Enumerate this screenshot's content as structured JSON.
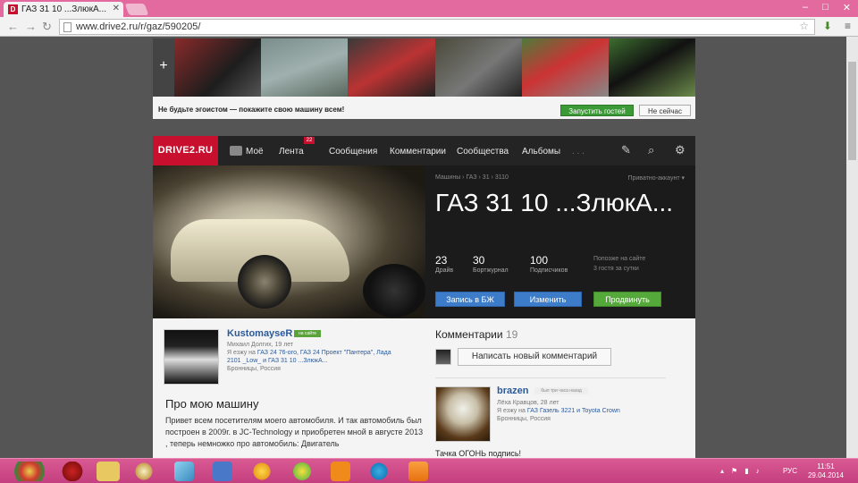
{
  "browser": {
    "tab_title": "ГАЗ 31 10 ...ЗлюкА...",
    "tab_favicon_letter": "D",
    "url": "www.drive2.ru/r/gaz/590205/",
    "win_min": "–",
    "win_max": "□",
    "win_close": "✕"
  },
  "promo": {
    "plus": "+",
    "text": "Не будьте эгоистом — покажите свою машину всем!",
    "launch_label": "Запустить гостей",
    "notnow_label": "Не сейчас"
  },
  "header": {
    "logo": "DRIVE2.RU",
    "menu": {
      "mine": "Моё",
      "feed": "Лента",
      "feed_badge": "22",
      "messages": "Сообщения",
      "comments": "Комментарии",
      "communities": "Сообщества",
      "albums": "Альбомы",
      "more": ". . ."
    }
  },
  "car": {
    "breadcrumb": "Машины › ГАЗ › 31 › 3110",
    "privacy": "Приватно-аккаунт ▾",
    "title": "ГАЗ 31 10 ...ЗлюкА...",
    "stats": [
      {
        "n": "23",
        "l": "Драйв"
      },
      {
        "n": "30",
        "l": "Бортжурнал"
      },
      {
        "n": "100",
        "l": "Подписчиков"
      }
    ],
    "stat_r1": "Попозже на сайте",
    "stat_r2": "3 гостя за сутки",
    "btn_log": "Запись в БЖ",
    "btn_edit": "Изменить",
    "btn_promote": "Продвинуть"
  },
  "owner": {
    "name": "KustomayseR",
    "onsite": "на сайте",
    "meta1": "Михаил Долгих, 19 лет",
    "meta2_prefix": "Я езжу на",
    "meta2_cars": "ГАЗ 24 76-ого, ГАЗ 24 Проект \"Пантера\", Лада 2101 _Low_ и ГАЗ 31 10 ...ЗлюкА...",
    "meta3": "Бронницы, Россия"
  },
  "about": {
    "heading": "Про мою машину",
    "text": "Привет всем посетителям моего автомобиля. И так автомобиль был построен в 2009г. в JC-Technology и приобретен мной в августе 2013 , теперь немножко про автомобиль: Двигатель"
  },
  "comments": {
    "heading": "Комментарии",
    "count": "19",
    "write_label": "Написать новый комментарий",
    "items": [
      {
        "name": "brazen",
        "badge": "был три часа назад",
        "meta1": "Лёха Кравцов, 28 лет",
        "meta2_prefix": "Я езжу на",
        "meta2_cars": "ГАЗ Газель 3221 и Toyota Crown",
        "meta3": "Бронницы, Россия",
        "text": "Тачка ОГОНЬ подпись!"
      }
    ]
  },
  "taskbar": {
    "lang": "РУС",
    "time": "11:51",
    "date": "29.04.2014"
  }
}
